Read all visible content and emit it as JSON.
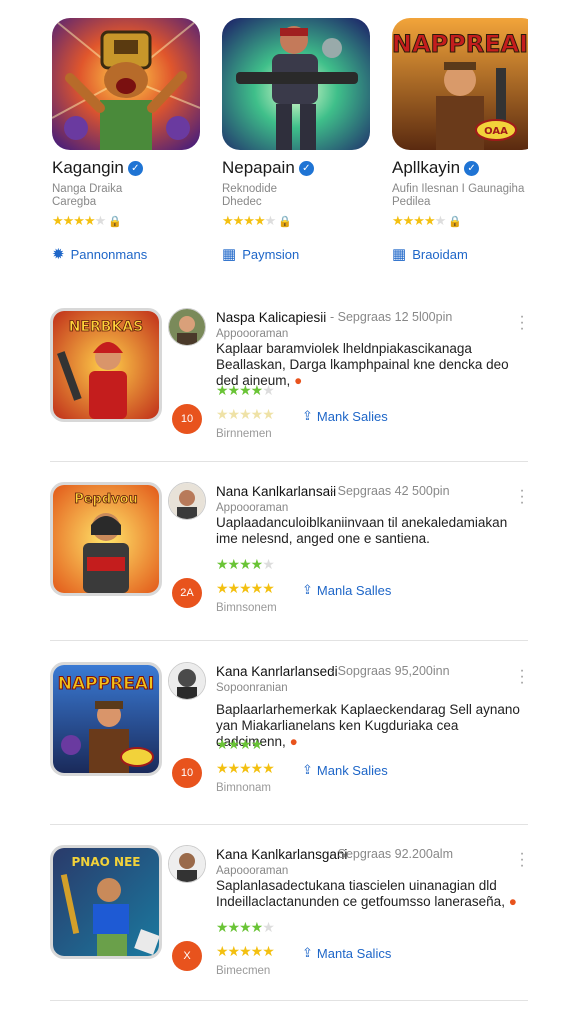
{
  "featured": [
    {
      "name": "Kagangin",
      "developer": "Nanga Draika",
      "category": "Caregba",
      "rating": 4,
      "link": "Pannonmans",
      "link_icon": "gear-icon"
    },
    {
      "name": "Nepapain",
      "developer": "Reknodide",
      "category": "Dhedec",
      "rating": 4,
      "link": "Paymsion",
      "link_icon": "grid-icon"
    },
    {
      "name": "Apllkayin",
      "developer": "Aufin Ilesnan I Gaunagiha",
      "category": "Pedilea",
      "rating": 4,
      "link": "Braoidam",
      "link_icon": "grid-icon"
    }
  ],
  "reviews": [
    {
      "title": "Naspa Kalicapiesii",
      "meta": "- Sepgraas  12 5l00pin",
      "author": "Appoooraman",
      "body": "Kaplaar baramviolek lheldnpiakascikanaga Beallaskan, Darga lkamphpainal kne dencka deo ded aineum,",
      "stars_green": 4,
      "badge": "10",
      "stars_gold": 5,
      "action": "Mank Salies",
      "footer": "Birnnemen",
      "thumb_caption": "NERBKAS"
    },
    {
      "title": "Nana Kanlkarlansaii",
      "meta": "- Sepgraas  42 500pin",
      "author": "Appoooraman",
      "body": "Uaplaadanculoiblkaniinvaan til anekaledamiakan ime nelesnd, anged one e santiena.",
      "stars_green": 4,
      "badge": "2A",
      "stars_gold": 5,
      "action": "Manla Salles",
      "footer": "Bimnsonem",
      "thumb_caption": "Pepdvou"
    },
    {
      "title": "Kana Kanrlarlansedi",
      "meta": "- Sopgraas  95,200inn",
      "author": "Sopoonranian",
      "body": "Baplaarlarhemerkak Kaplaeckendarag Sell aynano yan Miakarlianelans ken Kugduriaka cea dadcimenn,",
      "stars_green": 4,
      "badge": "10",
      "stars_gold": 5,
      "action": "Mank Salies",
      "footer": "Bimnonam",
      "thumb_caption": "NAPPREAI"
    },
    {
      "title": "Kana Kanlkarlansgani",
      "meta": "- Sepgraas  92.200alm",
      "author": "Aapoooraman",
      "body": "Saplanlasadectukana tiascielen uinanagian dld Indeillaclactanunden ce getfoumsso laneraseña,",
      "stars_green": 4,
      "badge": "X",
      "stars_gold": 5,
      "action": "Manta Salics",
      "footer": "Bimecmen",
      "thumb_caption": "PNAO NEE"
    }
  ],
  "colors": {
    "accent_blue": "#1e66c8",
    "verified": "#1f74d4",
    "badge_orange": "#e8531d",
    "star_gold": "#f3c011",
    "star_green": "#6ac436"
  }
}
